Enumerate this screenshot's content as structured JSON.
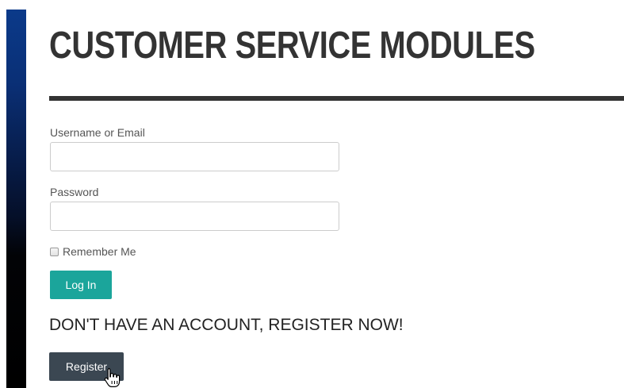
{
  "page_title": "CUSTOMER SERVICE MODULES",
  "login_form": {
    "username_label": "Username or Email",
    "username_value": "",
    "password_label": "Password",
    "password_value": "",
    "remember_label": "Remember Me",
    "remember_checked": false,
    "login_button_label": "Log In"
  },
  "register": {
    "heading": "DON'T HAVE AN ACCOUNT, REGISTER NOW!",
    "button_label": "Register"
  },
  "cursor_icon": "hand-pointer-icon",
  "colors": {
    "login_button": "#1ba59b",
    "register_button": "#3b4752",
    "title_text": "#333333"
  }
}
